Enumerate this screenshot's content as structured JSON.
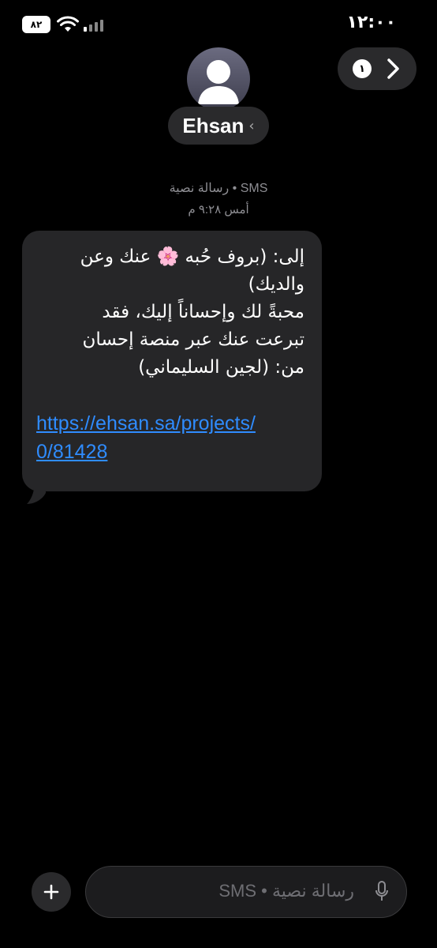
{
  "status_bar": {
    "time": "١٢:٠٠",
    "battery_level": "٨٢"
  },
  "header": {
    "contact_name": "Ehsan",
    "back_chevron": "‹",
    "unread_count": "١"
  },
  "message_meta": {
    "service": "رسالة نصية • SMS",
    "timestamp": "أمس ٩:٢٨ م"
  },
  "message": {
    "lines": [
      "إلى: (بروف حُبه 🌸 عنك وعن",
      "والديك)",
      "محبةً لك وإحساناً إليك، فقد",
      "تبرعت عنك عبر منصة إحسان",
      "من: (لجين السليماني)"
    ],
    "link_lines": [
      "https://ehsan.sa/projects/",
      "0/81428"
    ]
  },
  "composer": {
    "placeholder": "رسالة نصية • SMS"
  },
  "icons": {
    "plus": "plus-icon",
    "mic": "microphone-icon",
    "avatar": "person-icon",
    "forward": "chevron-right-icon"
  },
  "colors": {
    "background": "#000000",
    "bubble": "#262628",
    "link": "#2f8cff",
    "secondary_text": "#8e8e93"
  }
}
